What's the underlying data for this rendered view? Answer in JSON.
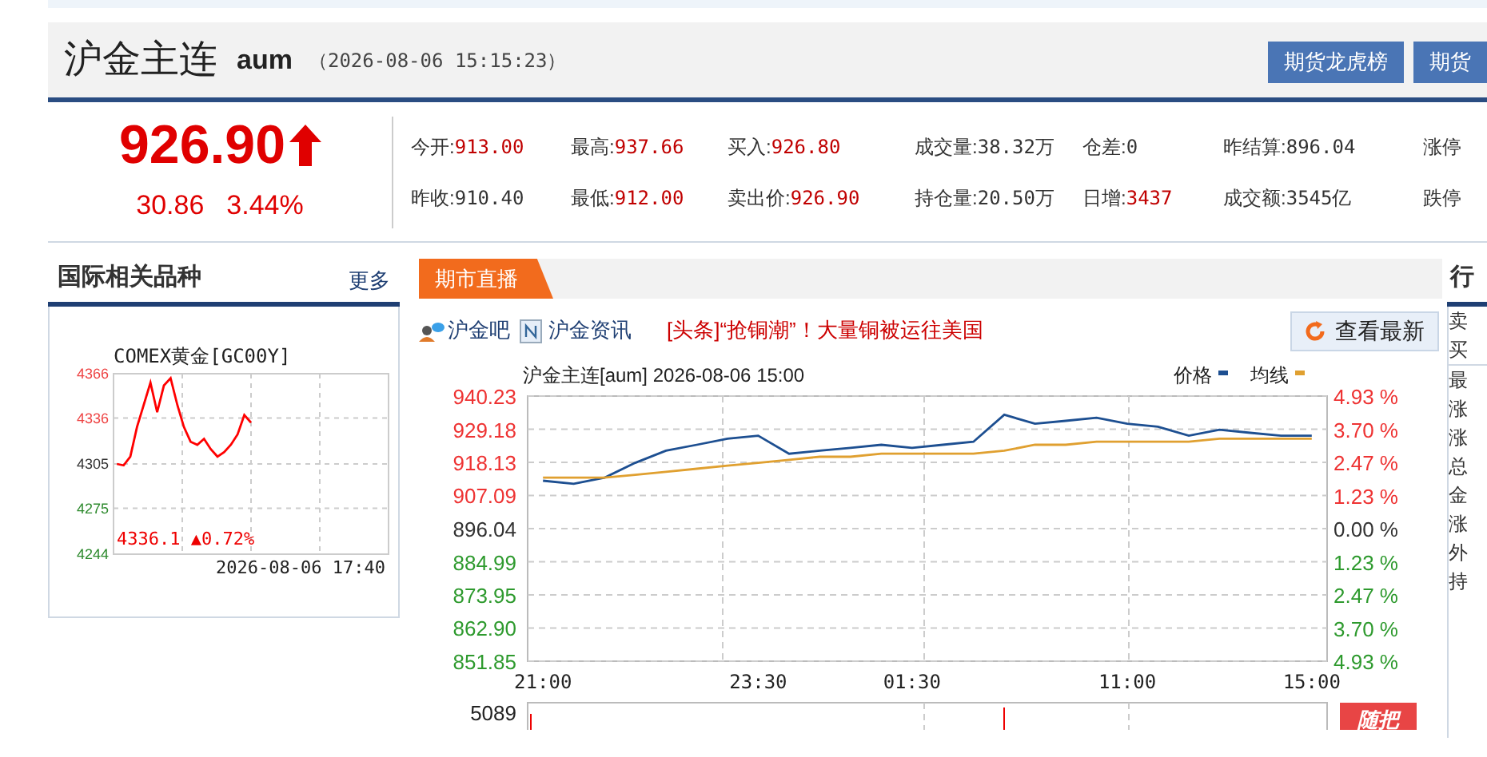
{
  "header": {
    "title": "沪金主连",
    "code": "aum",
    "time": "（2026-08-06 15:15:23）",
    "buttons": [
      "期货龙虎榜",
      "期货"
    ]
  },
  "quote": {
    "price": "926.90",
    "rising": true,
    "change": "30.86",
    "change_pct": "3.44%"
  },
  "stats": {
    "rows": [
      {
        "items": [
          {
            "label": "今开:",
            "value": "913.00",
            "kind": "up"
          },
          {
            "label": "最高:",
            "value": "937.66",
            "kind": "up"
          },
          {
            "label": "买入:",
            "value": "926.80",
            "kind": "up"
          },
          {
            "label": "成交量:",
            "value": "38.32万",
            "kind": "flat"
          },
          {
            "label": "仓差:",
            "value": "0",
            "kind": "flat"
          },
          {
            "label": "昨结算:",
            "value": "896.04",
            "kind": "flat"
          },
          {
            "label": "涨停"
          }
        ]
      },
      {
        "items": [
          {
            "label": "昨收:",
            "value": "910.40",
            "kind": "flat"
          },
          {
            "label": "最低:",
            "value": "912.00",
            "kind": "up"
          },
          {
            "label": "卖出价:",
            "value": "926.90",
            "kind": "up"
          },
          {
            "label": "持仓量:",
            "value": "20.50万",
            "kind": "flat"
          },
          {
            "label": "日增:",
            "value": "3437",
            "kind": "up"
          },
          {
            "label": "成交额:",
            "value": "3545亿",
            "kind": "flat"
          },
          {
            "label": "跌停"
          }
        ]
      }
    ]
  },
  "intl_panel": {
    "title": "国际相关品种",
    "more_link": "更多",
    "chart_title": "COMEX黄金[GC00Y]",
    "last": "4336.1 ▲0.72%",
    "date": "2026-08-06 17:40",
    "chart_data": {
      "type": "line",
      "grid": true,
      "categories": [
        null,
        null,
        null,
        null,
        null,
        null,
        null,
        null,
        null,
        null,
        null,
        null,
        null,
        null,
        null,
        null,
        null,
        null,
        null,
        null,
        null,
        null,
        null,
        null,
        null,
        null,
        null,
        null,
        null,
        null,
        null,
        null,
        null,
        null,
        null,
        null,
        null,
        null,
        null,
        null,
        null
      ],
      "ylim": [
        4244,
        4366
      ],
      "yticks": [
        {
          "value": 4244,
          "label": "4244"
        },
        {
          "value": 4275,
          "label": "4275"
        },
        {
          "value": 4305,
          "label": "4305"
        },
        {
          "value": 4336,
          "label": "4336"
        },
        {
          "value": 4366,
          "label": "4366"
        }
      ],
      "series": [
        {
          "color": "#ff0000",
          "values": [
            4305,
            4304,
            4310,
            4330,
            4345,
            4360,
            4340,
            4358,
            4363,
            4345,
            4330,
            4320,
            4318,
            4322,
            4315,
            4310,
            4313,
            4318,
            4325,
            4338,
            4333,
            null,
            null,
            null,
            null,
            null,
            null,
            null,
            null,
            null,
            null,
            null,
            null,
            null,
            null,
            null,
            null,
            null,
            null,
            null,
            null
          ]
        }
      ]
    }
  },
  "live": {
    "tab": "期市直播",
    "links": [
      "沪金吧",
      "沪金资讯"
    ],
    "headline": "[头条]“抢铜潮”！大量铜被运往美国",
    "refresh_button": "查看最新",
    "chart": {
      "title": "沪金主连[aum] 2026-08-06 15:00",
      "right_ticks": [
        {
          "label": "4.93 %",
          "kind": "up"
        },
        {
          "label": "3.70 %",
          "kind": "up"
        },
        {
          "label": "2.47 %",
          "kind": "up"
        },
        {
          "label": "1.23 %",
          "kind": "up"
        },
        {
          "label": "0.00 %",
          "kind": "flat"
        },
        {
          "label": "1.23 %",
          "kind": "down"
        },
        {
          "label": "2.47 %",
          "kind": "down"
        },
        {
          "label": "3.70 %",
          "kind": "down"
        },
        {
          "label": "4.93 %",
          "kind": "down"
        }
      ],
      "chart_data": {
        "type": "line",
        "grid": true,
        "legend": "top-right",
        "categories": [
          "21:00",
          null,
          null,
          null,
          null,
          null,
          null,
          "23:30",
          null,
          null,
          null,
          null,
          "01:30",
          null,
          null,
          null,
          null,
          null,
          null,
          "11:00",
          null,
          null,
          null,
          null,
          null,
          "15:00"
        ],
        "ylim": [
          851.85,
          940.23
        ],
        "yticks": [
          {
            "value": 851.85,
            "label": "851.85"
          },
          {
            "value": 862.9,
            "label": "862.90"
          },
          {
            "value": 873.95,
            "label": "873.95"
          },
          {
            "value": 884.99,
            "label": "884.99"
          },
          {
            "value": 896.04,
            "label": "896.04"
          },
          {
            "value": 907.09,
            "label": "907.09"
          },
          {
            "value": 918.13,
            "label": "918.13"
          },
          {
            "value": 929.18,
            "label": "929.18"
          },
          {
            "value": 940.23,
            "label": "940.23"
          }
        ],
        "series": [
          {
            "name": "价格",
            "color": "#1d4f91",
            "values": [
              912,
              911,
              913,
              918,
              922,
              924,
              926,
              927,
              921,
              922,
              923,
              924,
              923,
              924,
              925,
              934,
              931,
              932,
              933,
              931,
              930,
              927,
              929,
              928,
              927,
              927
            ]
          },
          {
            "name": "均线",
            "color": "#e0a030",
            "values": [
              913,
              913,
              913,
              914,
              915,
              916,
              917,
              918,
              919,
              920,
              920,
              921,
              921,
              921,
              921,
              922,
              924,
              924,
              925,
              925,
              925,
              925,
              926,
              926,
              926,
              926
            ]
          }
        ]
      }
    },
    "volume": {
      "max_label": "5089",
      "badge": "随把"
    }
  },
  "side": {
    "title": "行",
    "rows": [
      "卖",
      "买",
      "最",
      "涨",
      "涨",
      "总",
      "金",
      "涨",
      "外",
      "持"
    ]
  }
}
